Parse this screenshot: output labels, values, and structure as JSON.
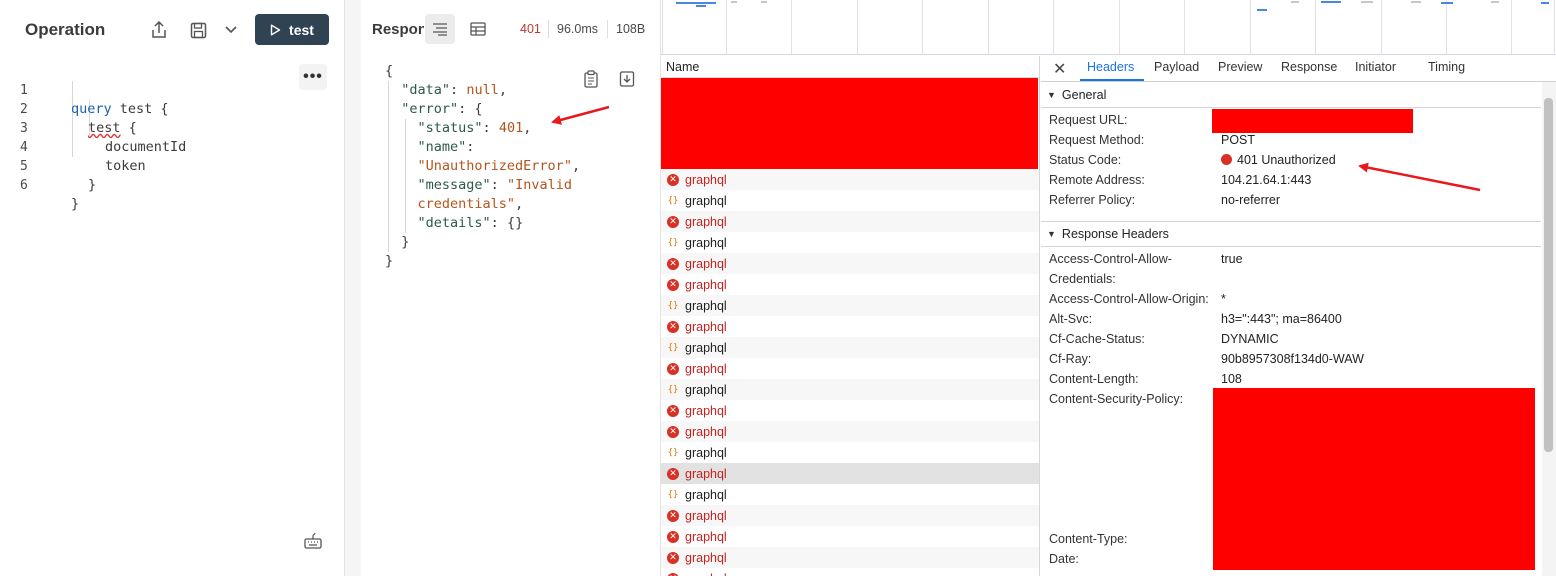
{
  "operation": {
    "title": "Operation",
    "run_label": "test",
    "lines": [
      "1",
      "2",
      "3",
      "4",
      "5",
      "6"
    ],
    "code": {
      "l1_kw": "query",
      "l1_rest": " test {",
      "l2_field": "test",
      "l2_rest": " {",
      "l3": "documentId",
      "l4": "token",
      "l5": "}",
      "l6": "}"
    },
    "more_label": "•••"
  },
  "response": {
    "title": "Respon",
    "status": "401",
    "time": "96.0ms",
    "size": "108B",
    "json": {
      "open": "{",
      "data_key": "\"data\"",
      "data_val": "null",
      "error_key": "\"error\"",
      "status_key": "\"status\"",
      "status_val": "401",
      "name_key": "\"name\"",
      "name_val": "\"UnauthorizedError\"",
      "message_key": "\"message\"",
      "message_val_1": "\"Invalid",
      "message_val_2": "credentials\"",
      "details_key": "\"details\"",
      "details_val": "{}",
      "inner_close": "}",
      "close": "}"
    }
  },
  "devtools": {
    "list_header": "Name",
    "requests": [
      {
        "name": "graphql",
        "kind": "error"
      },
      {
        "name": "graphql",
        "kind": "ok"
      },
      {
        "name": "graphql",
        "kind": "error"
      },
      {
        "name": "graphql",
        "kind": "ok"
      },
      {
        "name": "graphql",
        "kind": "error"
      },
      {
        "name": "graphql",
        "kind": "error"
      },
      {
        "name": "graphql",
        "kind": "ok"
      },
      {
        "name": "graphql",
        "kind": "error"
      },
      {
        "name": "graphql",
        "kind": "ok"
      },
      {
        "name": "graphql",
        "kind": "error"
      },
      {
        "name": "graphql",
        "kind": "ok"
      },
      {
        "name": "graphql",
        "kind": "error"
      },
      {
        "name": "graphql",
        "kind": "error"
      },
      {
        "name": "graphql",
        "kind": "ok"
      },
      {
        "name": "graphql",
        "kind": "error",
        "selected": true
      },
      {
        "name": "graphql",
        "kind": "ok"
      },
      {
        "name": "graphql",
        "kind": "error"
      },
      {
        "name": "graphql",
        "kind": "error"
      },
      {
        "name": "graphql",
        "kind": "error"
      },
      {
        "name": "graphql",
        "kind": "error"
      }
    ],
    "tabs": [
      "Headers",
      "Payload",
      "Preview",
      "Response",
      "Initiator",
      "Timing"
    ],
    "active_tab": "Headers",
    "general": {
      "title": "General",
      "request_url_label": "Request URL:",
      "request_method_label": "Request Method:",
      "request_method": "POST",
      "status_code_label": "Status Code:",
      "status_code": "401 Unauthorized",
      "remote_address_label": "Remote Address:",
      "remote_address": "104.21.64.1:443",
      "referrer_policy_label": "Referrer Policy:",
      "referrer_policy": "no-referrer"
    },
    "response_headers": {
      "title": "Response Headers",
      "acac_label_1": "Access-Control-Allow-",
      "acac_label_2": "Credentials:",
      "acac": "true",
      "acao_label": "Access-Control-Allow-Origin:",
      "acao": "*",
      "alt_svc_label": "Alt-Svc:",
      "alt_svc": "h3=\":443\"; ma=86400",
      "cf_cache_label": "Cf-Cache-Status:",
      "cf_cache": "DYNAMIC",
      "cf_ray_label": "Cf-Ray:",
      "cf_ray": "90b8957308f134d0-WAW",
      "content_length_label": "Content-Length:",
      "content_length": "108",
      "csp_label": "Content-Security-Policy:",
      "content_type_label": "Content-Type:",
      "date_label": "Date:"
    }
  },
  "colors": {
    "run_button": "#2f4353",
    "error": "#d93025",
    "accent": "#1a73e8",
    "redaction": "#ff0000",
    "annotation_arrow": "#e8191b"
  }
}
